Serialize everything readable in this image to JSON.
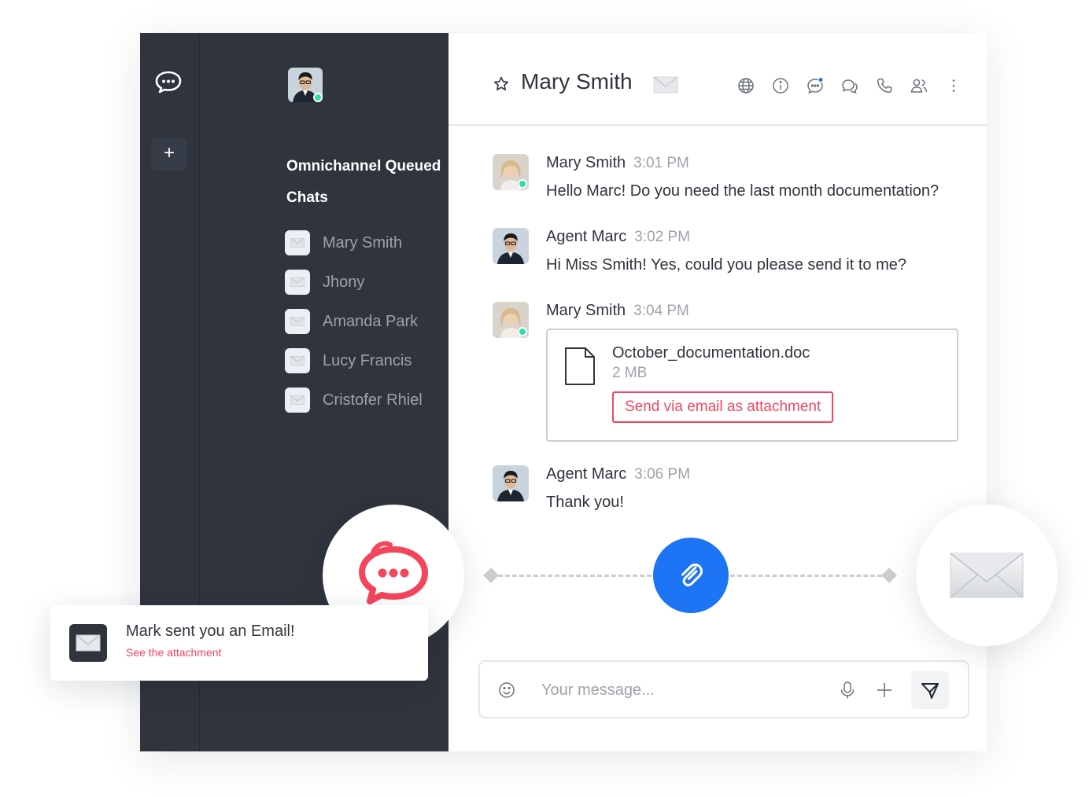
{
  "colors": {
    "sidebar_bg": "#2f343d",
    "accent_red": "#f5455c",
    "accent_blue": "#1d74f5",
    "online": "#2de0a5",
    "muted_text": "#9ea2a8"
  },
  "rail": {
    "logo_icon": "rocketchat-logo-icon",
    "add_label": "+"
  },
  "sidebar": {
    "section_title": "Omnichannel Queued Chats",
    "rooms": [
      {
        "label": "Mary Smith",
        "icon": "email-icon"
      },
      {
        "label": "Jhony",
        "icon": "email-icon"
      },
      {
        "label": "Amanda Park",
        "icon": "email-icon"
      },
      {
        "label": "Lucy Francis",
        "icon": "email-icon"
      },
      {
        "label": "Cristofer Rhiel",
        "icon": "email-icon"
      }
    ]
  },
  "header": {
    "title": "Mary Smith",
    "icons": [
      "globe-icon",
      "info-icon",
      "discussion-icon",
      "threads-icon",
      "phone-icon",
      "members-icon",
      "kebab-menu-icon"
    ]
  },
  "messages": [
    {
      "author": "Mary Smith",
      "time": "3:01 PM",
      "text": "Hello Marc! Do you need the last month documentation?"
    },
    {
      "author": "Agent Marc",
      "time": "3:02 PM",
      "text": "Hi Miss Smith! Yes, could you please send it to me?"
    },
    {
      "author": "Mary Smith",
      "time": "3:04 PM",
      "text": ""
    },
    {
      "author": "Agent Marc",
      "time": "3:06 PM",
      "text": "Thank you!"
    }
  ],
  "attachment": {
    "file_name": "October_documentation.doc",
    "file_size": "2 MB",
    "action_label": "Send via email as attachment"
  },
  "composer": {
    "placeholder": "Your message..."
  },
  "toast": {
    "title": "Mark sent you an Email!",
    "subtitle": "See the attachment"
  }
}
